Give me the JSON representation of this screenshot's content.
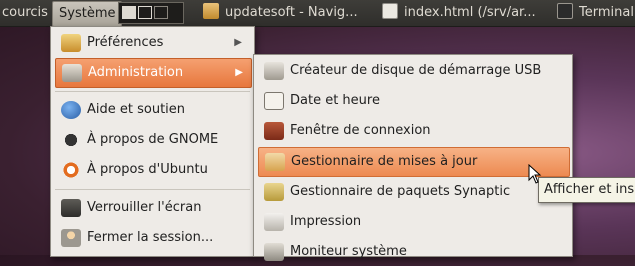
{
  "panel": {
    "raccourcis": "courcis",
    "systeme": "Système",
    "tasks": [
      {
        "label": "updatesoft - Navig...",
        "icon": "folder-icon"
      },
      {
        "label": "index.html (/srv/ar...",
        "icon": "document-icon"
      },
      {
        "label": "Terminal",
        "icon": "terminal-icon"
      }
    ]
  },
  "system_menu": {
    "items": [
      {
        "label": "Préférences",
        "icon": "preferences-icon"
      },
      {
        "label": "Administration",
        "icon": "administration-icon"
      },
      {
        "label": "Aide et soutien",
        "icon": "help-icon"
      },
      {
        "label": "À propos de GNOME",
        "icon": "gnome-icon"
      },
      {
        "label": "À propos d'Ubuntu",
        "icon": "ubuntu-icon"
      },
      {
        "label": "Verrouiller l'écran",
        "icon": "lock-screen-icon"
      },
      {
        "label": "Fermer la session...",
        "icon": "logout-icon"
      }
    ]
  },
  "admin_menu": {
    "items": [
      {
        "label": "Créateur de disque de démarrage USB",
        "icon": "usb-icon"
      },
      {
        "label": "Date et heure",
        "icon": "calendar-icon"
      },
      {
        "label": "Fenêtre de connexion",
        "icon": "login-window-icon"
      },
      {
        "label": "Gestionnaire de mises à jour",
        "icon": "update-manager-icon"
      },
      {
        "label": "Gestionnaire de paquets Synaptic",
        "icon": "package-icon"
      },
      {
        "label": "Impression",
        "icon": "printer-icon"
      },
      {
        "label": "Moniteur système",
        "icon": "monitor-icon"
      }
    ]
  },
  "tooltip": "Afficher et ins",
  "colors": {
    "highlight": "#e7773d",
    "panel": "#3a3935",
    "menu_bg": "#eeebe7"
  }
}
